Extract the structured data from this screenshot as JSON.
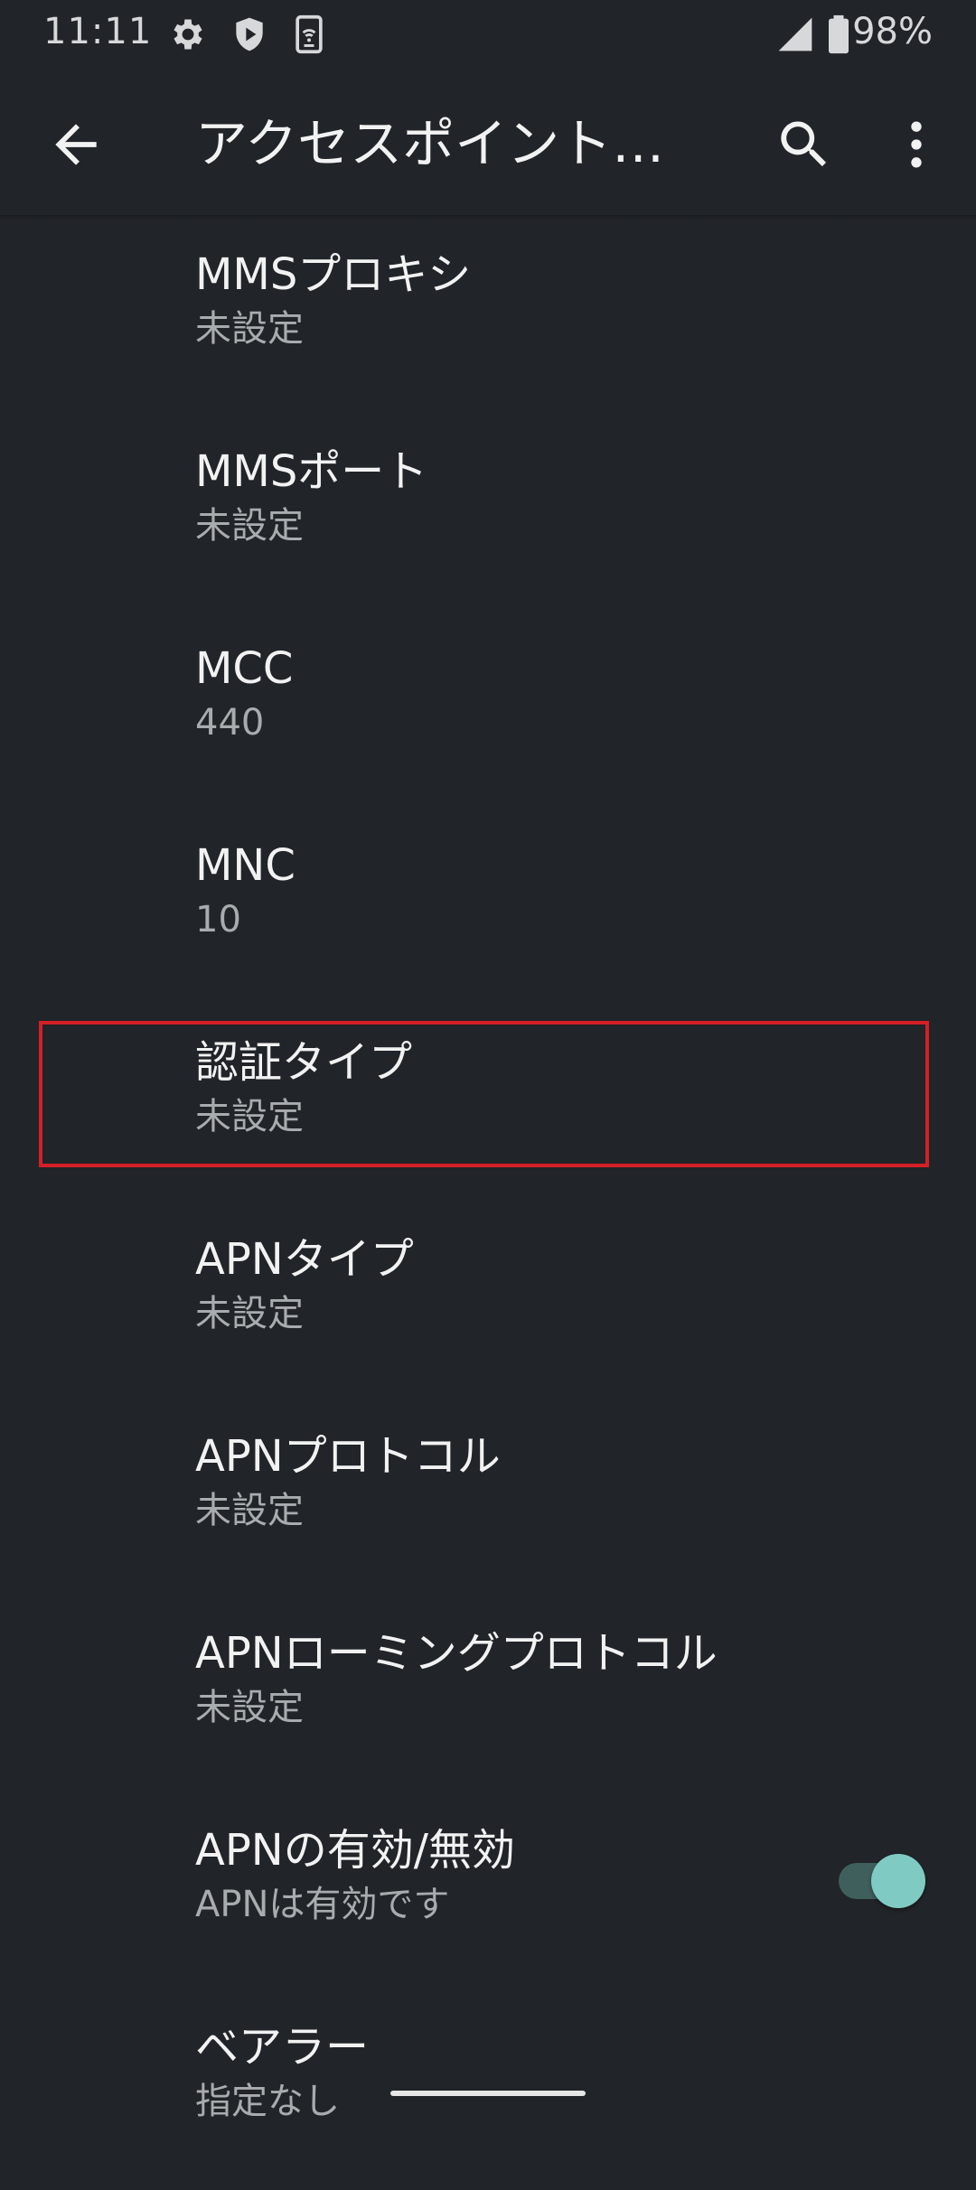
{
  "status_bar": {
    "time": "11:11",
    "battery_percent": "98%",
    "icons": [
      "settings-gear-icon",
      "shield-play-icon",
      "phone-wifi-icon",
      "cell-signal-icon",
      "battery-icon"
    ]
  },
  "app_bar": {
    "title": "アクセスポイント…",
    "back_icon": "arrow-back-icon",
    "search_icon": "search-icon",
    "overflow_icon": "more-vert-icon"
  },
  "preferences": [
    {
      "title": "MMSプロキシ",
      "summary": "未設定"
    },
    {
      "title": "MMSポート",
      "summary": "未設定"
    },
    {
      "title": "MCC",
      "summary": "440"
    },
    {
      "title": "MNC",
      "summary": "10"
    },
    {
      "title": "認証タイプ",
      "summary": "未設定"
    },
    {
      "title": "APNタイプ",
      "summary": "未設定"
    },
    {
      "title": "APNプロトコル",
      "summary": "未設定"
    },
    {
      "title": "APNローミングプロトコル",
      "summary": "未設定"
    },
    {
      "title": "APNの有効/無効",
      "summary": "APNは有効です",
      "toggle_on": true
    },
    {
      "title": "ベアラー",
      "summary": "指定なし"
    }
  ],
  "colors": {
    "background": "#212428",
    "highlight": "#d51f26",
    "toggle_accent": "#7fcbc4"
  }
}
